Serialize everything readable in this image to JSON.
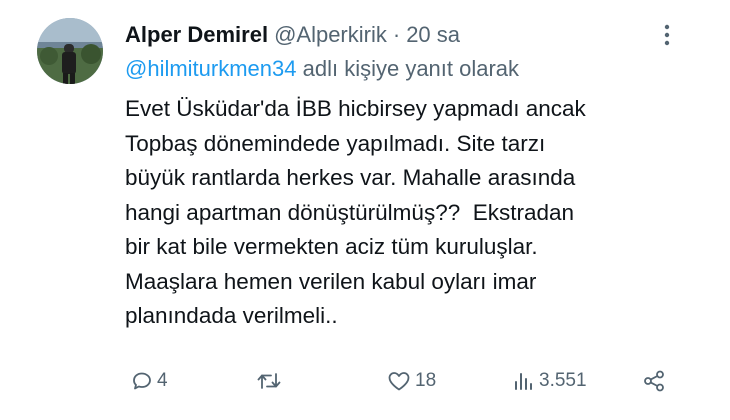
{
  "tweet": {
    "author_name": "Alper Demirel",
    "handle": "@Alperkirik",
    "separator": "·",
    "time": "20 sa",
    "reply_to_handle": "@hilmiturkmen34",
    "reply_suffix": " adlı kişiye yanıt olarak",
    "lines": [
      "Evet Üsküdar'da İBB hicbirsey yapmadı ancak",
      "Topbaş dönemindede yapılmadı. Site tarzı",
      "büyük rantlarda herkes var. Mahalle arasında",
      "hangi apartman dönüştürülmüş??  Ekstradan",
      "bir kat bile vermekten aciz tüm kuruluşlar.",
      "Maaşlara hemen verilen kabul oyları imar",
      "planındada verilmeli.."
    ]
  },
  "actions": {
    "replies": "4",
    "retweets": "",
    "likes": "18",
    "views": "3.551"
  },
  "icons": {
    "reply": "comment-icon",
    "retweet": "retweet-icon",
    "like": "heart-icon",
    "views": "bar-chart-icon",
    "share": "share-icon",
    "more": "more-dots-icon"
  },
  "colors": {
    "text": "#0f1419",
    "muted": "#536471",
    "mention": "#1d9bf0"
  }
}
